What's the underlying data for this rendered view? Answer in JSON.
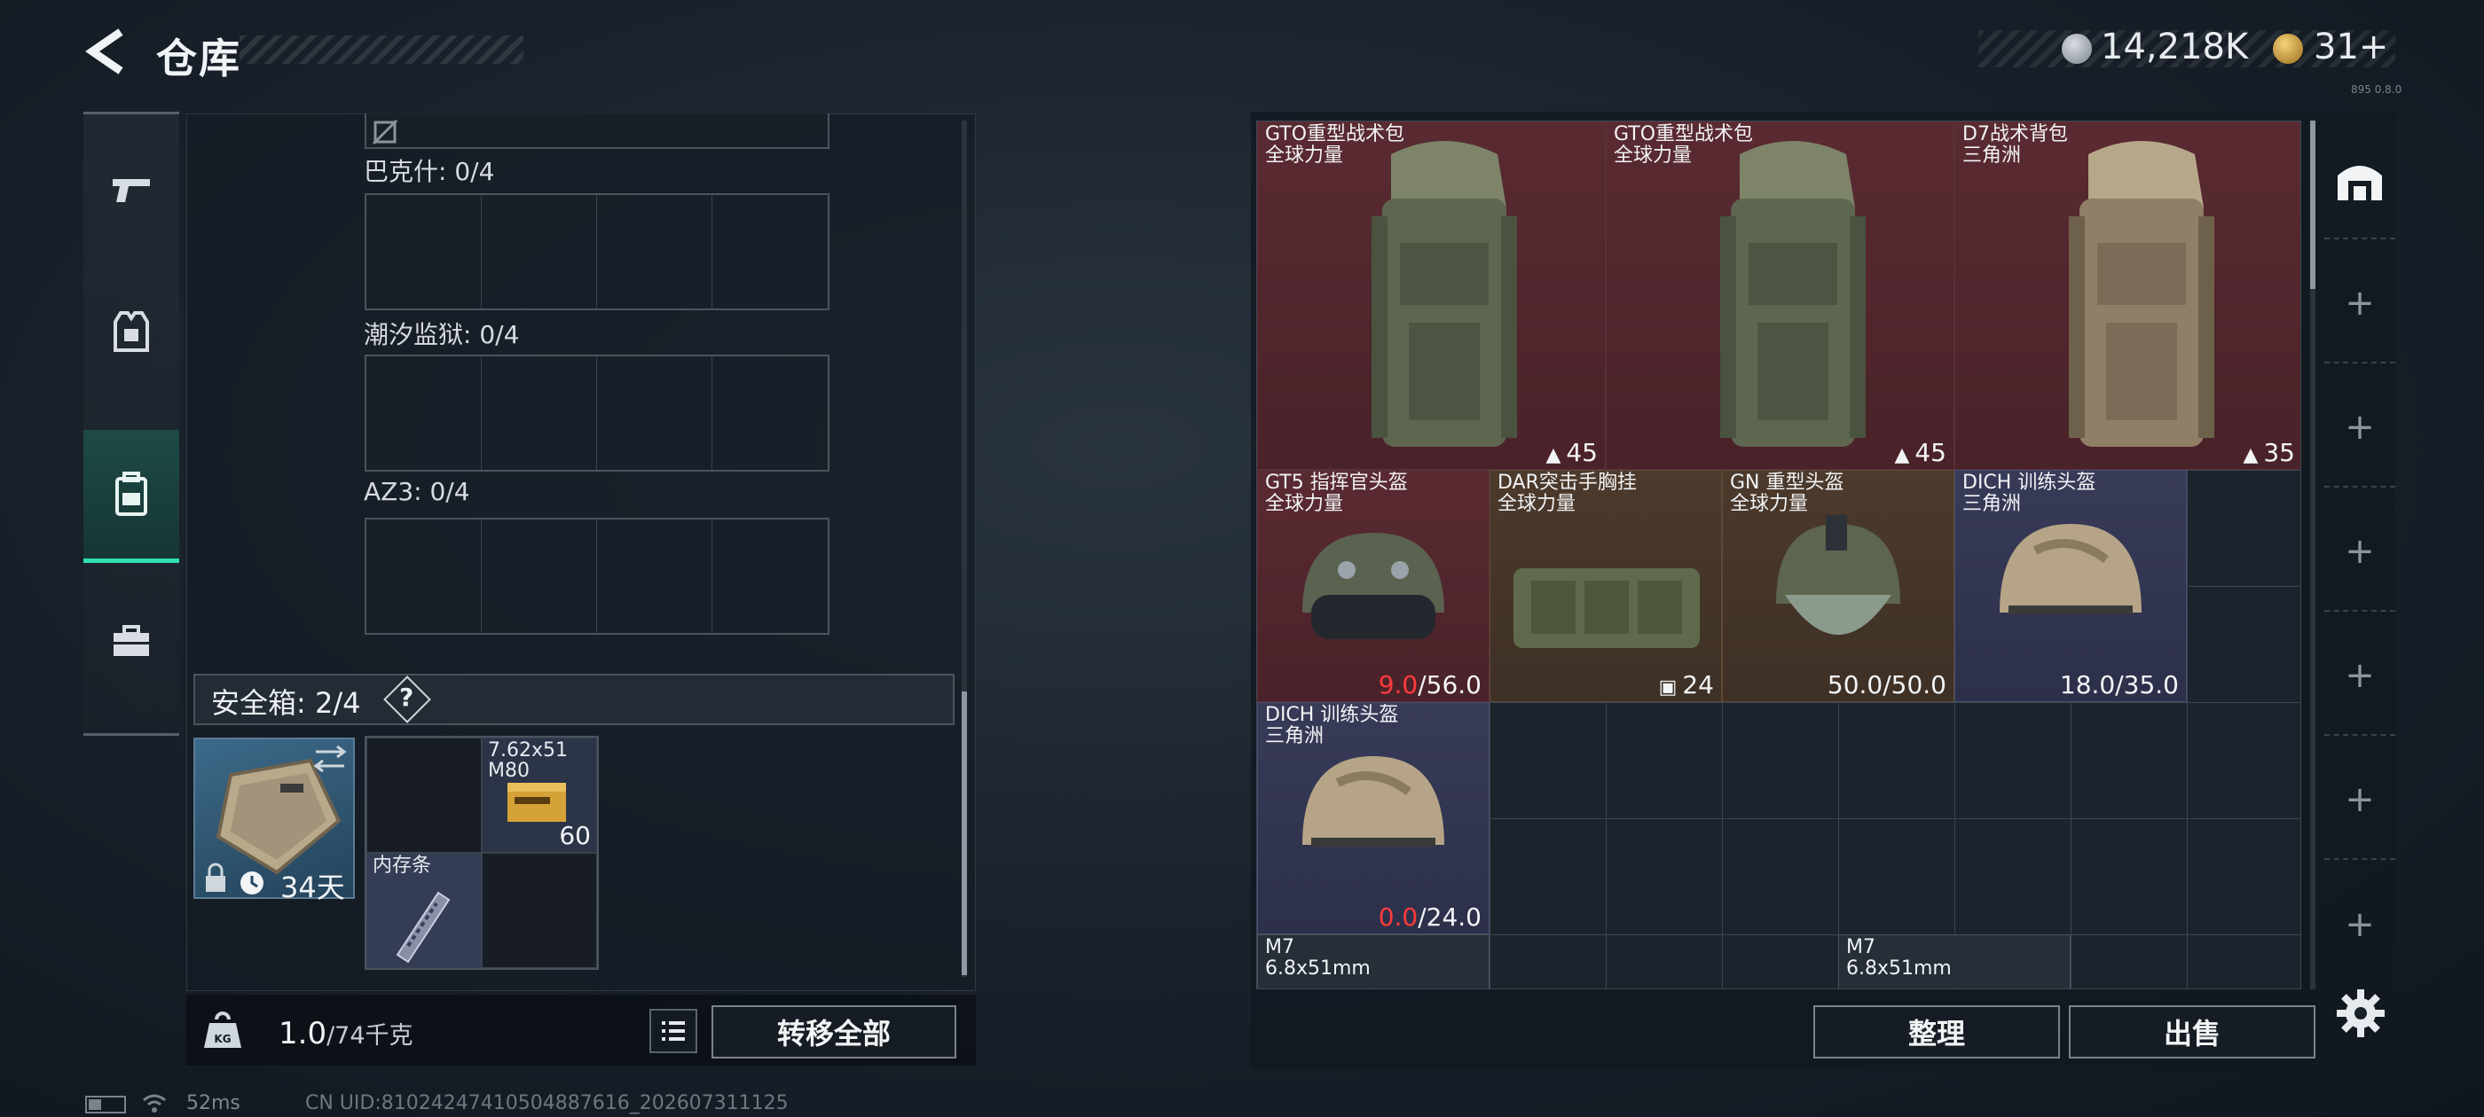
{
  "header": {
    "title": "仓库"
  },
  "currency": {
    "coins": "14,218K",
    "gold": "31+"
  },
  "left_nav": {
    "items": [
      "weapons",
      "equipment",
      "backpack",
      "toolbox"
    ],
    "active": 2
  },
  "containers": [
    {
      "label": "巴克什: 0/4"
    },
    {
      "label": "潮汐监狱: 0/4"
    },
    {
      "label": "AZ3: 0/4"
    }
  ],
  "safe_box": {
    "label": "安全箱: 2/4",
    "help": "?",
    "days": "34天",
    "items": [
      {
        "name": "7.62x51\nM80",
        "count": "60"
      },
      {
        "name": "内存条",
        "count": ""
      }
    ]
  },
  "weight": {
    "current": "1.0",
    "max": "/74千克",
    "kg_label": "KG"
  },
  "buttons": {
    "transfer_all": "转移全部",
    "sort": "整理",
    "sell": "出售"
  },
  "warehouse_items": [
    {
      "name": "GTO重型战术包\n全球力量",
      "value": "45",
      "rarity": "red"
    },
    {
      "name": "GTO重型战术包\n全球力量",
      "value": "45",
      "rarity": "red"
    },
    {
      "name": "D7战术背包\n三角洲",
      "value": "35",
      "rarity": "red"
    },
    {
      "name": "GT5 指挥官头盔\n全球力量",
      "dur_cur": "9.0",
      "dur_max": "/56.0",
      "rarity": "red"
    },
    {
      "name": "DAR突击手胸挂\n全球力量",
      "value": "24",
      "rarity": "brown"
    },
    {
      "name": "GN 重型头盔\n全球力量",
      "dur_cur": "50.0",
      "dur_max": "/50.0",
      "rarity": "brown"
    },
    {
      "name": "DICH 训练头盔\n三角洲",
      "dur_cur": "18.0",
      "dur_max": "/35.0",
      "rarity": "purple"
    },
    {
      "name": "DICH 训练头盔\n三角洲",
      "dur_cur": "0.0",
      "dur_max": "/24.0",
      "rarity": "purple"
    },
    {
      "name": "M7\n6.8x51mm",
      "rarity": "gray"
    },
    {
      "name": "M7\n6.8x51mm",
      "rarity": "gray"
    }
  ],
  "side_tabs": {
    "add_label": "+"
  },
  "status": {
    "ping": "52ms",
    "uid": "CN UID:81024247410504887616_202607311125",
    "version": "895 0.8.0"
  },
  "colors": {
    "accent": "#2fe0b0",
    "red_rarity": "#5a2a32",
    "purple_rarity": "#383b58",
    "low_durability": "#ff3b3b"
  }
}
